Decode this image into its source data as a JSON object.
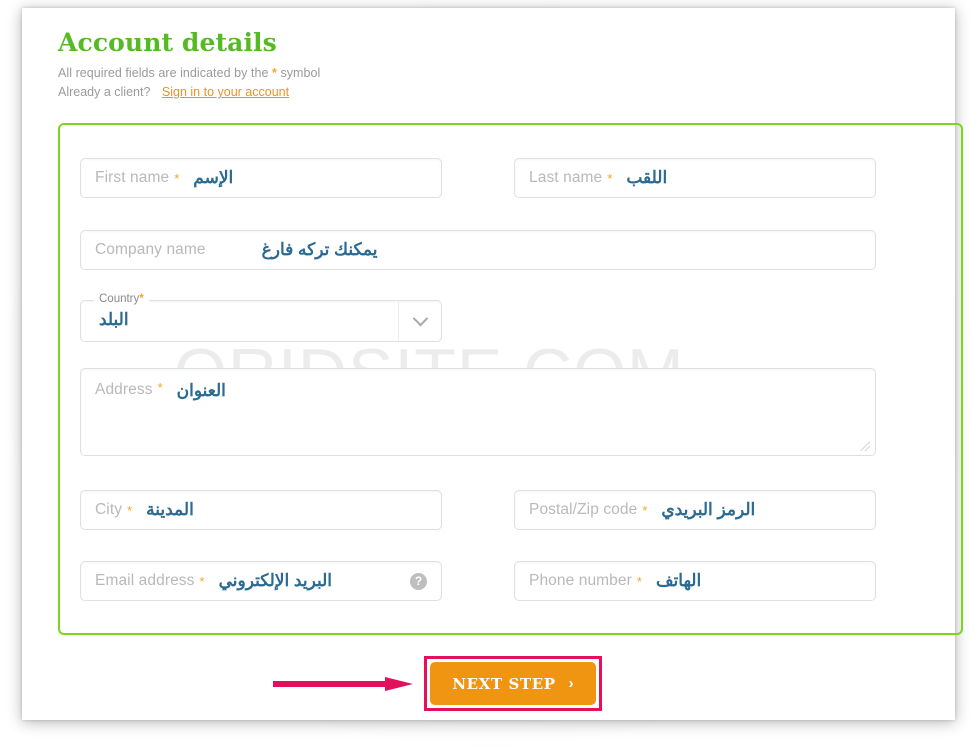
{
  "header": {
    "title": "Account details",
    "required_note_before": "All required fields are indicated by the",
    "required_symbol": "*",
    "required_note_after": "symbol",
    "already_client": "Already a client?",
    "signin_link": "Sign in to your account"
  },
  "watermark": "ORIDSITE.COM",
  "accent_colors": {
    "title_green": "#55bb22",
    "form_border_green": "#7ed321",
    "link_orange": "#e8932a",
    "required_star_orange": "#f5a623",
    "arabic_blue": "#2b6a92",
    "button_orange": "#f09512",
    "highlight_crimson": "#e3115b"
  },
  "form": {
    "fields": [
      {
        "name": "first-name",
        "placeholder": "First name",
        "required": true,
        "annotation_ar": "الإسم",
        "type": "text"
      },
      {
        "name": "last-name",
        "placeholder": "Last name",
        "required": true,
        "annotation_ar": "اللقب",
        "type": "text"
      },
      {
        "name": "company-name",
        "placeholder": "Company name",
        "required": false,
        "annotation_ar": "يمكنك تركه فارغ",
        "type": "text"
      },
      {
        "name": "country",
        "label": "Country",
        "required": true,
        "annotation_ar": "البلد",
        "type": "select",
        "icon": "chevron-down-icon"
      },
      {
        "name": "address",
        "placeholder": "Address",
        "required": true,
        "annotation_ar": "العنوان",
        "type": "textarea"
      },
      {
        "name": "city",
        "placeholder": "City",
        "required": true,
        "annotation_ar": "المدينة",
        "type": "text"
      },
      {
        "name": "postal-code",
        "placeholder": "Postal/Zip code",
        "required": true,
        "annotation_ar": "الرمز البريدي",
        "type": "text"
      },
      {
        "name": "email-address",
        "placeholder": "Email address",
        "required": true,
        "annotation_ar": "البريد الإلكتروني",
        "type": "email",
        "icon": "help-icon",
        "icon_glyph": "?"
      },
      {
        "name": "phone-number",
        "placeholder": "Phone number",
        "required": true,
        "annotation_ar": "الهاتف",
        "type": "tel"
      }
    ]
  },
  "footer": {
    "next_step_label": "NEXT STEP",
    "next_step_chevron": "›"
  }
}
